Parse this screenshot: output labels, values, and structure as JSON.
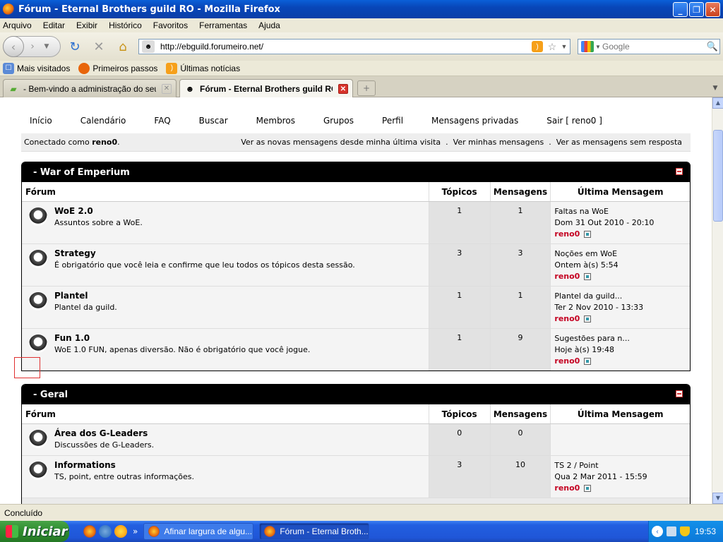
{
  "window": {
    "title": "Fórum - Eternal Brothers guild RO - Mozilla Firefox"
  },
  "menu": [
    "Arquivo",
    "Editar",
    "Exibir",
    "Histórico",
    "Favoritos",
    "Ferramentas",
    "Ajuda"
  ],
  "nav": {
    "url": "http://ebguild.forumeiro.net/",
    "search_placeholder": "Google"
  },
  "bookmarks": [
    "Mais visitados",
    "Primeiros passos",
    "Últimas notícias"
  ],
  "tabs": [
    {
      "label": "- Bem-vindo a administração do seu fór...",
      "active": false
    },
    {
      "label": "Fórum - Eternal Brothers guild RO",
      "active": true
    }
  ],
  "forum_nav": [
    "Início",
    "Calendário",
    "FAQ",
    "Buscar",
    "Membros",
    "Grupos",
    "Perfil",
    "Mensagens privadas",
    "Sair [ reno0 ]"
  ],
  "connected": {
    "prefix": "Conectado como ",
    "user": "reno0",
    "suffix": ".",
    "links": [
      "Ver as novas mensagens desde minha última visita",
      "Ver minhas mensagens",
      "Ver as mensagens sem resposta"
    ],
    "sep": "."
  },
  "columns": {
    "forum": "Fórum",
    "topics": "Tópicos",
    "messages": "Mensagens",
    "last": "Última Mensagem"
  },
  "sections": [
    {
      "title": "- War of Emperium",
      "forums": [
        {
          "title": "WoE 2.0",
          "desc": "Assuntos sobre a WoE.",
          "topics": "1",
          "messages": "1",
          "last_title": "Faltas na WoE",
          "last_date": "Dom 31 Out 2010 - 20:10",
          "last_author": "reno0"
        },
        {
          "title": "Strategy",
          "desc": "É obrigatório que você leia e confirme que leu todos os tópicos desta sessão.",
          "topics": "3",
          "messages": "3",
          "last_title": "Noções em WoE",
          "last_date": "Ontem à(s) 5:54",
          "last_author": "reno0"
        },
        {
          "title": "Plantel",
          "desc": "Plantel da guild.",
          "topics": "1",
          "messages": "1",
          "last_title": "Plantel da guild...",
          "last_date": "Ter 2 Nov 2010 - 13:33",
          "last_author": "reno0"
        },
        {
          "title": "Fun 1.0",
          "desc": "WoE 1.0 FUN, apenas diversão. Não é obrigatório que você jogue.",
          "topics": "1",
          "messages": "9",
          "last_title": "Sugestões para n...",
          "last_date": "Hoje à(s) 19:48",
          "last_author": "reno0"
        }
      ]
    },
    {
      "title": "- Geral",
      "forums": [
        {
          "title": "Área dos G-Leaders",
          "desc": "Discussões de G-Leaders.",
          "topics": "0",
          "messages": "0",
          "last_title": "",
          "last_date": "",
          "last_author": ""
        },
        {
          "title": "Informations",
          "desc": "TS, point, entre outras informações.",
          "topics": "3",
          "messages": "10",
          "last_title": "TS 2 / Point",
          "last_date": "Qua 2 Mar 2011 - 15:59",
          "last_author": "reno0"
        }
      ]
    }
  ],
  "status": "Concluído",
  "taskbar": {
    "start": "Iniciar",
    "tasks": [
      "Afinar largura de algu...",
      "Fórum - Eternal Broth..."
    ],
    "clock": "19:53"
  }
}
